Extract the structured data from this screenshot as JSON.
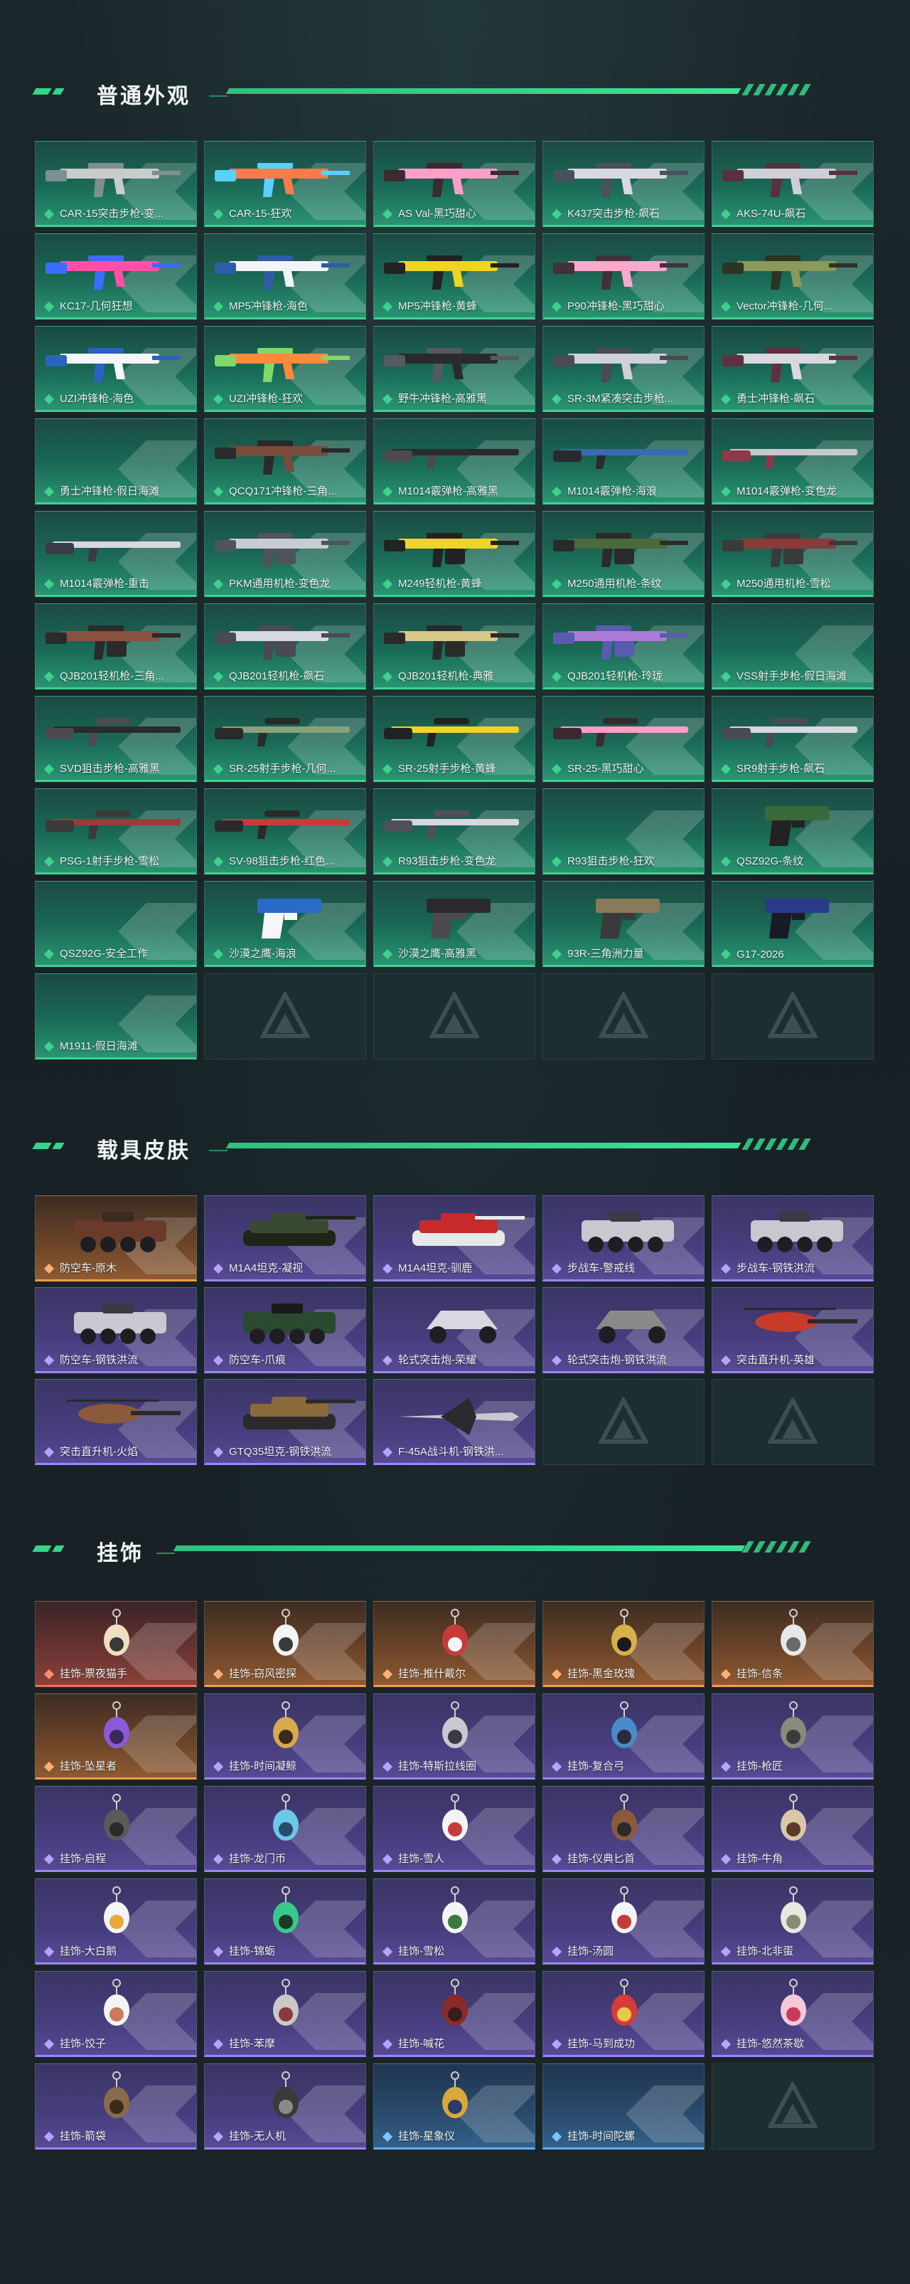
{
  "sections": [
    {
      "title": "普通外观",
      "cards": [
        {
          "label": "CAR-15突击步枪-变...",
          "rarity": "teal",
          "icon": "rifle-icon",
          "colors": [
            "#c9cccc",
            "#7d8f8f"
          ]
        },
        {
          "label": "CAR-15-狂欢",
          "rarity": "teal",
          "icon": "rifle-icon",
          "colors": [
            "#ff7a4a",
            "#5ad0ff"
          ]
        },
        {
          "label": "AS Val-黑巧甜心",
          "rarity": "teal",
          "icon": "rifle-icon",
          "colors": [
            "#ff9ec8",
            "#3b2a30"
          ]
        },
        {
          "label": "K437突击步枪-飙石",
          "rarity": "teal",
          "icon": "rifle-icon",
          "colors": [
            "#d8d8e0",
            "#4a5060"
          ]
        },
        {
          "label": "AKS-74U-飙石",
          "rarity": "teal",
          "icon": "rifle-icon",
          "colors": [
            "#cfcfd8",
            "#5a3040"
          ]
        },
        {
          "label": "KC17-几何狂想",
          "rarity": "teal",
          "icon": "rifle-icon",
          "colors": [
            "#ff4fa6",
            "#3a6cff"
          ]
        },
        {
          "label": "MP5冲锋枪-海色",
          "rarity": "teal",
          "icon": "smg-icon",
          "colors": [
            "#f2f5f7",
            "#2e5ca6"
          ]
        },
        {
          "label": "MP5冲锋枪-黄蜂",
          "rarity": "teal",
          "icon": "smg-icon",
          "colors": [
            "#f0d424",
            "#222222"
          ]
        },
        {
          "label": "P90冲锋枪-黑巧甜心",
          "rarity": "teal",
          "icon": "smg-icon",
          "colors": [
            "#ffa8cc",
            "#42303a"
          ]
        },
        {
          "label": "Vector冲锋枪-几何...",
          "rarity": "teal",
          "icon": "smg-icon",
          "colors": [
            "#8a9a5a",
            "#2c3424"
          ]
        },
        {
          "label": "UZI冲锋枪-海色",
          "rarity": "teal",
          "icon": "smg-icon",
          "colors": [
            "#f4f6f8",
            "#2a62c0"
          ]
        },
        {
          "label": "UZI冲锋枪-狂欢",
          "rarity": "teal",
          "icon": "smg-icon",
          "colors": [
            "#ff8a3a",
            "#80d86a"
          ]
        },
        {
          "label": "野牛冲锋枪-高雅黑",
          "rarity": "teal",
          "icon": "smg-icon",
          "colors": [
            "#2a2a2e",
            "#555960"
          ]
        },
        {
          "label": "SR-3M紧凑突击步枪...",
          "rarity": "teal",
          "icon": "rifle-icon",
          "colors": [
            "#d0d0d8",
            "#4a4a52"
          ]
        },
        {
          "label": "勇士冲锋枪-飙石",
          "rarity": "teal",
          "icon": "smg-icon",
          "colors": [
            "#d8d8de",
            "#603040"
          ]
        },
        {
          "label": "勇士冲锋枪-假日海滩",
          "rarity": "teal",
          "icon": "none",
          "colors": [
            "#1a6a56",
            "#1a6a56"
          ]
        },
        {
          "label": "QCQ171冲锋枪-三角...",
          "rarity": "teal",
          "icon": "smg-icon",
          "colors": [
            "#7a4a3a",
            "#2a2a2a"
          ]
        },
        {
          "label": "M1014霰弹枪-高雅黑",
          "rarity": "teal",
          "icon": "shotgun-icon",
          "colors": [
            "#2a2a2e",
            "#4a4a50"
          ]
        },
        {
          "label": "M1014霰弹枪-海浪",
          "rarity": "teal",
          "icon": "shotgun-icon",
          "colors": [
            "#3a6ab0",
            "#2a2a2e"
          ]
        },
        {
          "label": "M1014霰弹枪-变色龙",
          "rarity": "teal",
          "icon": "shotgun-icon",
          "colors": [
            "#c8c8d0",
            "#8a3a4a"
          ]
        },
        {
          "label": "M1014霰弹枪-重击",
          "rarity": "teal",
          "icon": "shotgun-icon",
          "colors": [
            "#d8d8e0",
            "#3a3a48"
          ]
        },
        {
          "label": "PKM通用机枪-变色龙",
          "rarity": "teal",
          "icon": "lmg-icon",
          "colors": [
            "#c8ccd0",
            "#50545a"
          ]
        },
        {
          "label": "M249轻机枪-黄蜂",
          "rarity": "teal",
          "icon": "lmg-icon",
          "colors": [
            "#f0d424",
            "#222222"
          ]
        },
        {
          "label": "M250通用机枪-条纹",
          "rarity": "teal",
          "icon": "lmg-icon",
          "colors": [
            "#4a6a3a",
            "#2a2a2a"
          ]
        },
        {
          "label": "M250通用机枪-雪松",
          "rarity": "teal",
          "icon": "lmg-icon",
          "colors": [
            "#8a3a3a",
            "#3a3a3a"
          ]
        },
        {
          "label": "QJB201轻机枪-三角...",
          "rarity": "teal",
          "icon": "lmg-icon",
          "colors": [
            "#8a5040",
            "#2a2a2a"
          ]
        },
        {
          "label": "QJB201轻机枪-飙石",
          "rarity": "teal",
          "icon": "lmg-icon",
          "colors": [
            "#d8d8e0",
            "#4a4a52"
          ]
        },
        {
          "label": "QJB201轻机枪-典雅",
          "rarity": "teal",
          "icon": "lmg-icon",
          "colors": [
            "#d8c88a",
            "#2a2a2a"
          ]
        },
        {
          "label": "QJB201轻机枪-玲珑",
          "rarity": "teal",
          "icon": "lmg-icon",
          "colors": [
            "#b07ad8",
            "#5a5ab0"
          ]
        },
        {
          "label": "VSS射手步枪-假日海滩",
          "rarity": "teal",
          "icon": "none",
          "colors": [
            "#1a6a56",
            "#1a6a56"
          ]
        },
        {
          "label": "SVD狙击步枪-高雅黑",
          "rarity": "teal",
          "icon": "sniper-icon",
          "colors": [
            "#2a2a2e",
            "#4a4a50"
          ]
        },
        {
          "label": "SR-25射手步枪-几何...",
          "rarity": "teal",
          "icon": "sniper-icon",
          "colors": [
            "#8aa07a",
            "#2a2a2a"
          ]
        },
        {
          "label": "SR-25射手步枪-黄蜂",
          "rarity": "teal",
          "icon": "sniper-icon",
          "colors": [
            "#f0d424",
            "#222222"
          ]
        },
        {
          "label": "SR-25-黑巧甜心",
          "rarity": "teal",
          "icon": "sniper-icon",
          "colors": [
            "#ff9ec8",
            "#3a2a30"
          ]
        },
        {
          "label": "SR9射手步枪-飙石",
          "rarity": "teal",
          "icon": "sniper-icon",
          "colors": [
            "#d8d8e0",
            "#4a4a52"
          ]
        },
        {
          "label": "PSG-1射手步枪-雪松",
          "rarity": "teal",
          "icon": "sniper-icon",
          "colors": [
            "#9a3a3a",
            "#3a3a3a"
          ]
        },
        {
          "label": "SV-98狙击步枪-红色...",
          "rarity": "teal",
          "icon": "sniper-icon",
          "colors": [
            "#c83a3a",
            "#2a2a2a"
          ]
        },
        {
          "label": "R93狙击步枪-变色龙",
          "rarity": "teal",
          "icon": "sniper-icon",
          "colors": [
            "#d8d8e0",
            "#50505a"
          ]
        },
        {
          "label": "R93狙击步枪-狂欢",
          "rarity": "teal",
          "icon": "none",
          "colors": [
            "#1a6a56",
            "#1a6a56"
          ]
        },
        {
          "label": "QSZ92G-条纹",
          "rarity": "teal",
          "icon": "pistol-icon",
          "colors": [
            "#3a6a3a",
            "#222222"
          ]
        },
        {
          "label": "QSZ92G-安全工作",
          "rarity": "teal",
          "icon": "none",
          "colors": [
            "#1a6a56",
            "#1a6a56"
          ]
        },
        {
          "label": "沙漠之鹰-海浪",
          "rarity": "teal",
          "icon": "pistol-icon",
          "colors": [
            "#2a6ac8",
            "#f4f6f8"
          ]
        },
        {
          "label": "沙漠之鹰-高雅黑",
          "rarity": "teal",
          "icon": "pistol-icon",
          "colors": [
            "#2a2a2e",
            "#4a4a50"
          ]
        },
        {
          "label": "93R-三角洲力量",
          "rarity": "teal",
          "icon": "pistol-icon",
          "colors": [
            "#8a7a5a",
            "#3a3a3a"
          ]
        },
        {
          "label": "G17-2026",
          "rarity": "teal",
          "icon": "pistol-icon",
          "colors": [
            "#2a3a8a",
            "#1a1a2a"
          ]
        },
        {
          "label": "M1911-假日海滩",
          "rarity": "teal",
          "icon": "none",
          "colors": [
            "#1a6a56",
            "#1a6a56"
          ]
        },
        {
          "label": "",
          "rarity": "empty",
          "icon": "none",
          "colors": []
        },
        {
          "label": "",
          "rarity": "empty",
          "icon": "none",
          "colors": []
        },
        {
          "label": "",
          "rarity": "empty",
          "icon": "none",
          "colors": []
        },
        {
          "label": "",
          "rarity": "empty",
          "icon": "none",
          "colors": []
        }
      ]
    },
    {
      "title": "载具皮肤",
      "cards": [
        {
          "label": "防空车-原木",
          "rarity": "orange",
          "icon": "apc-icon",
          "colors": [
            "#6a3a2a",
            "#3a2a22"
          ]
        },
        {
          "label": "M1A4坦克-凝视",
          "rarity": "purple",
          "icon": "tank-icon",
          "colors": [
            "#3a4a30",
            "#1e2418"
          ]
        },
        {
          "label": "M1A4坦克-驯鹿",
          "rarity": "purple",
          "icon": "tank-icon",
          "colors": [
            "#c82a2a",
            "#e8e8e8"
          ]
        },
        {
          "label": "步战车-警戒线",
          "rarity": "purple",
          "icon": "apc-icon",
          "colors": [
            "#c8c8d0",
            "#3a3a42"
          ]
        },
        {
          "label": "步战车-钢铁洪流",
          "rarity": "purple",
          "icon": "apc-icon",
          "colors": [
            "#c8c8d0",
            "#3a3a42"
          ]
        },
        {
          "label": "防空车-钢铁洪流",
          "rarity": "purple",
          "icon": "apc-icon",
          "colors": [
            "#c8c8d0",
            "#3a3a42"
          ]
        },
        {
          "label": "防空车-爪痕",
          "rarity": "purple",
          "icon": "apc-icon",
          "colors": [
            "#2a4a30",
            "#1a1a1a"
          ]
        },
        {
          "label": "轮式突击炮-荣耀",
          "rarity": "purple",
          "icon": "buggy-icon",
          "colors": [
            "#d8d8e0",
            "#3a3a42"
          ]
        },
        {
          "label": "轮式突击炮-钢铁洪流",
          "rarity": "purple",
          "icon": "buggy-icon",
          "colors": [
            "#8a8a8a",
            "#2a2a2a"
          ]
        },
        {
          "label": "突击直升机-英雄",
          "rarity": "purple",
          "icon": "helicopter-icon",
          "colors": [
            "#c83a2a",
            "#2a2a2a"
          ]
        },
        {
          "label": "突击直升机-火焰",
          "rarity": "purple",
          "icon": "helicopter-icon",
          "colors": [
            "#8a5a3a",
            "#2a2a2a"
          ]
        },
        {
          "label": "GTQ35坦克-钢铁洪流",
          "rarity": "purple",
          "icon": "tank-icon",
          "colors": [
            "#8a6a3a",
            "#2a2a2a"
          ]
        },
        {
          "label": "F-45A战斗机-钢铁洪...",
          "rarity": "purple",
          "icon": "jet-icon",
          "colors": [
            "#c8c8d0",
            "#2a2a30"
          ]
        },
        {
          "label": "",
          "rarity": "empty",
          "icon": "none",
          "colors": []
        },
        {
          "label": "",
          "rarity": "empty",
          "icon": "none",
          "colors": []
        }
      ]
    },
    {
      "title": "挂饰",
      "cards": [
        {
          "label": "挂饰-票夜猫手",
          "rarity": "red",
          "icon": "charm-icon",
          "colors": [
            "#f0e0c0",
            "#3a3a3a"
          ]
        },
        {
          "label": "挂饰-窃风密探",
          "rarity": "orange",
          "icon": "charm-icon",
          "colors": [
            "#f4f4f4",
            "#3a3a3a"
          ]
        },
        {
          "label": "挂饰-推什戴尔",
          "rarity": "orange",
          "icon": "charm-icon",
          "colors": [
            "#c83a3a",
            "#f4f4f4"
          ]
        },
        {
          "label": "挂饰-黑金玫瑰",
          "rarity": "orange",
          "icon": "charm-icon",
          "colors": [
            "#d8b04a",
            "#1a1a1a"
          ]
        },
        {
          "label": "挂饰-信条",
          "rarity": "orange",
          "icon": "charm-icon",
          "colors": [
            "#e8e8e8",
            "#6a6a6a"
          ]
        },
        {
          "label": "挂饰-坠星者",
          "rarity": "orange",
          "icon": "charm-icon",
          "colors": [
            "#8a5ad8",
            "#3a2a5a"
          ]
        },
        {
          "label": "挂饰-时间凝鲸",
          "rarity": "purple",
          "icon": "charm-icon",
          "colors": [
            "#d8a84a",
            "#3a2a1a"
          ]
        },
        {
          "label": "挂饰-特斯拉线圈",
          "rarity": "purple",
          "icon": "charm-icon",
          "colors": [
            "#c8c8d0",
            "#3a3a42"
          ]
        },
        {
          "label": "挂饰-复合弓",
          "rarity": "purple",
          "icon": "charm-icon",
          "colors": [
            "#4a8ac8",
            "#2a2a3a"
          ]
        },
        {
          "label": "挂饰-枪匠",
          "rarity": "purple",
          "icon": "charm-icon",
          "colors": [
            "#8a8a7a",
            "#3a3a3a"
          ]
        },
        {
          "label": "挂饰-启程",
          "rarity": "purple",
          "icon": "charm-icon",
          "colors": [
            "#5a5a5a",
            "#2a2a2a"
          ]
        },
        {
          "label": "挂饰-龙门币",
          "rarity": "purple",
          "icon": "charm-icon",
          "colors": [
            "#6ac8e8",
            "#2a4a6a"
          ]
        },
        {
          "label": "挂饰-雪人",
          "rarity": "purple",
          "icon": "charm-icon",
          "colors": [
            "#f4f4f4",
            "#c83a3a"
          ]
        },
        {
          "label": "挂饰-仪典匕首",
          "rarity": "purple",
          "icon": "charm-icon",
          "colors": [
            "#8a5a3a",
            "#2a2a2a"
          ]
        },
        {
          "label": "挂饰-牛角",
          "rarity": "purple",
          "icon": "charm-icon",
          "colors": [
            "#d8c8a8",
            "#5a3a2a"
          ]
        },
        {
          "label": "挂饰-大白鹅",
          "rarity": "purple",
          "icon": "charm-icon",
          "colors": [
            "#f4f4f4",
            "#e8a83a"
          ]
        },
        {
          "label": "挂饰-锦蛎",
          "rarity": "purple",
          "icon": "charm-icon",
          "colors": [
            "#3ac88a",
            "#1a3a2a"
          ]
        },
        {
          "label": "挂饰-雪松",
          "rarity": "purple",
          "icon": "charm-icon",
          "colors": [
            "#f4f4f4",
            "#3a7a3a"
          ]
        },
        {
          "label": "挂饰-汤圆",
          "rarity": "purple",
          "icon": "charm-icon",
          "colors": [
            "#f4f4f4",
            "#c83a3a"
          ]
        },
        {
          "label": "挂饰-北非蛋",
          "rarity": "purple",
          "icon": "charm-icon",
          "colors": [
            "#e8e8e0",
            "#8a8a7a"
          ]
        },
        {
          "label": "挂饰-饺子",
          "rarity": "purple",
          "icon": "charm-icon",
          "colors": [
            "#f4f4f4",
            "#c87a5a"
          ]
        },
        {
          "label": "挂饰-苯摩",
          "rarity": "purple",
          "icon": "charm-icon",
          "colors": [
            "#c8c8c8",
            "#8a3a3a"
          ]
        },
        {
          "label": "挂饰-喊花",
          "rarity": "purple",
          "icon": "charm-icon",
          "colors": [
            "#8a2a2a",
            "#3a1a1a"
          ]
        },
        {
          "label": "挂饰-马到成功",
          "rarity": "purple",
          "icon": "charm-icon",
          "colors": [
            "#d83a3a",
            "#e8c84a"
          ]
        },
        {
          "label": "挂饰-悠然茶歇",
          "rarity": "purple",
          "icon": "charm-icon",
          "colors": [
            "#f4c8d8",
            "#c83a5a"
          ]
        },
        {
          "label": "挂饰-箭袋",
          "rarity": "purple",
          "icon": "charm-icon",
          "colors": [
            "#8a6a4a",
            "#3a2a1a"
          ]
        },
        {
          "label": "挂饰-无人机",
          "rarity": "purple",
          "icon": "charm-icon",
          "colors": [
            "#3a3a3a",
            "#8a8a8a"
          ]
        },
        {
          "label": "挂饰-星象仪",
          "rarity": "blue",
          "icon": "charm-icon",
          "colors": [
            "#d8a83a",
            "#2a3a6a"
          ]
        },
        {
          "label": "挂饰-时间陀螺",
          "rarity": "blue",
          "icon": "none",
          "colors": [
            "#2a4b6c",
            "#2a4b6c"
          ]
        },
        {
          "label": "",
          "rarity": "empty",
          "icon": "none",
          "colors": []
        }
      ]
    }
  ]
}
